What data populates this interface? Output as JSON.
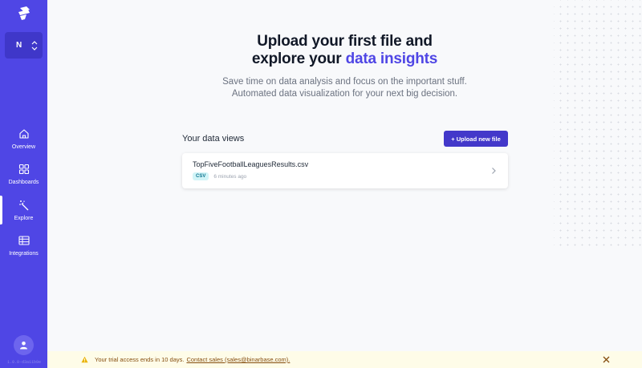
{
  "sidebar": {
    "workspace_initial": "N",
    "nav": [
      {
        "label": "Overview",
        "icon": "home-icon"
      },
      {
        "label": "Dashboards",
        "icon": "grid-icon"
      },
      {
        "label": "Explore",
        "icon": "magic-wand-icon",
        "active": true
      },
      {
        "label": "Integrations",
        "icon": "table-icon"
      }
    ],
    "version": "1.0.0-d3a11b9e"
  },
  "hero": {
    "title_line1": "Upload your first file and",
    "title_line2_prefix": "explore your ",
    "title_line2_accent": "data insights",
    "subtitle_line1": "Save time on data analysis and focus on the important stuff.",
    "subtitle_line2": "Automated data visualization for your next big decision."
  },
  "views": {
    "title": "Your data views",
    "upload_label": "+ Upload new file",
    "files": [
      {
        "name": "TopFiveFootballLeaguesResults.csv",
        "type": "CSV",
        "time": "6 minutes ago"
      }
    ]
  },
  "banner": {
    "text": "Your trial access ends in 10 days.",
    "link": "Contact sales (sales@binarbase.com)."
  },
  "colors": {
    "accent": "#4f46e5",
    "sidebar": "#4f46e5",
    "banner_bg": "#fefce8"
  }
}
